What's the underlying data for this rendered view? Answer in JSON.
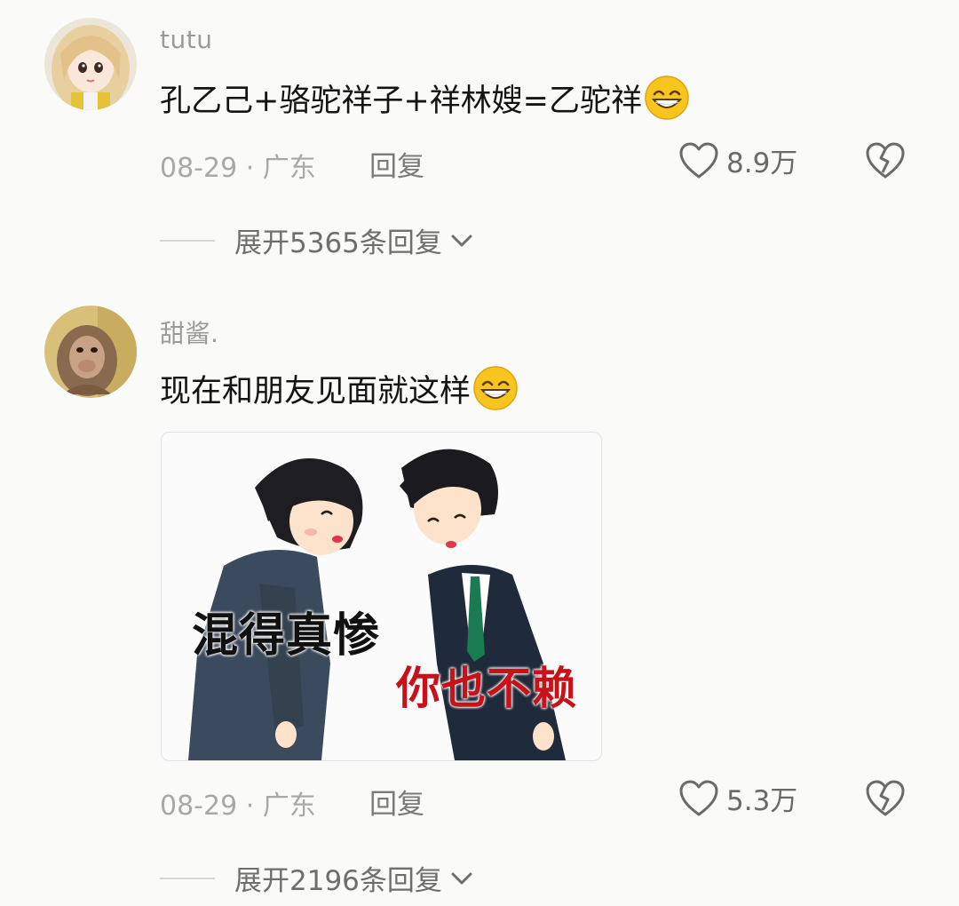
{
  "comments": [
    {
      "username": "tutu",
      "text": "孔乙己+骆驼祥子+祥林嫂=乙驼祥",
      "emoji": "grinning-sweat-emoji",
      "date_location": "08-29 · 广东",
      "reply_label": "回复",
      "likes": "8.9万",
      "expand_label": "展开5365条回复"
    },
    {
      "username": "甜酱.",
      "text": "现在和朋友见面就这样",
      "emoji": "grinning-sweat-emoji",
      "meme": {
        "caption_left": "混得真惨",
        "caption_right": "你也不赖"
      },
      "date_location": "08-29 · 广东",
      "reply_label": "回复",
      "likes": "5.3万",
      "expand_label": "展开2196条回复"
    }
  ],
  "colors": {
    "background": "#fafaf8",
    "username": "#9a9a9a",
    "meta": "#a8a8a8",
    "caption_red": "#c8121a"
  },
  "icons": [
    "heart-outline-icon",
    "broken-heart-icon",
    "chevron-down-icon"
  ]
}
